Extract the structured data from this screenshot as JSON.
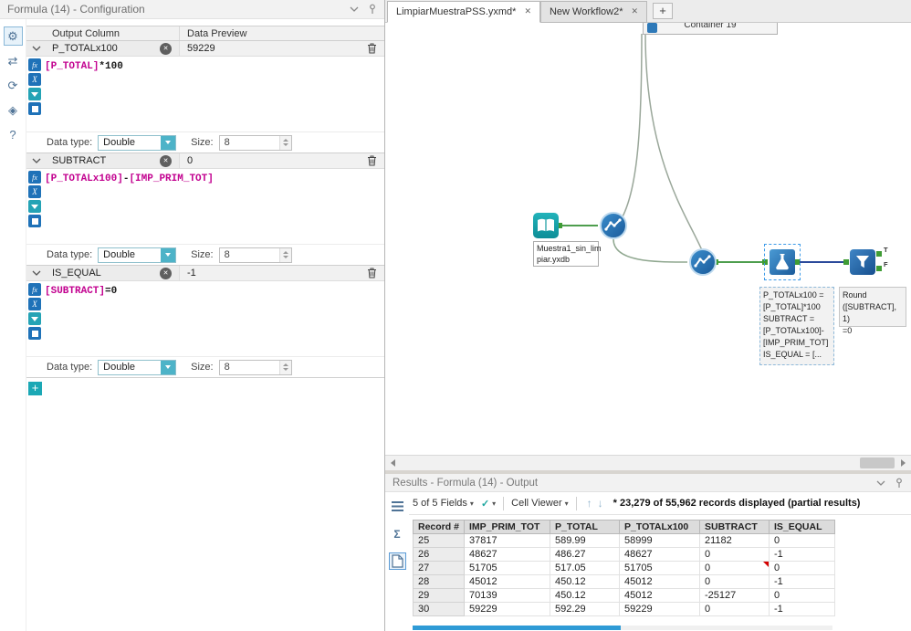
{
  "icons": {
    "gear": "⚙",
    "swap": "⇄",
    "refresh": "⟳",
    "tag": "◈",
    "help": "?",
    "close": "✕",
    "plus": "+",
    "check": "✓",
    "caret": "▾",
    "up_arrow": "↑",
    "down_arrow": "↓",
    "sigma": "Σ",
    "fx": "fx",
    "x_var": "X"
  },
  "config": {
    "title": "Formula (14) - Configuration",
    "header": {
      "output_column": "Output Column",
      "data_preview": "Data Preview"
    },
    "data_type_label": "Data type:",
    "size_label": "Size:",
    "formulas": [
      {
        "name": "P_TOTALx100",
        "preview": "59229",
        "expr": [
          {
            "t": "[P_TOTAL]"
          },
          {
            "t": "*100"
          }
        ],
        "data_type": "Double",
        "size": "8"
      },
      {
        "name": "SUBTRACT",
        "preview": "0",
        "expr": [
          {
            "t": "[P_TOTALx100]"
          },
          {
            "t": "-"
          },
          {
            "t": "[IMP_PRIM_TOT]"
          }
        ],
        "data_type": "Double",
        "size": "8"
      },
      {
        "name": "IS_EQUAL",
        "preview": "-1",
        "expr": [
          {
            "t": "[SUBTRACT]"
          },
          {
            "t": "=0"
          }
        ],
        "data_type": "Double",
        "size": "8"
      }
    ]
  },
  "tabs": {
    "items": [
      {
        "label": "LimpiarMuestraPSS.yxmd*"
      },
      {
        "label": "New Workflow2*"
      }
    ]
  },
  "canvas": {
    "container_label": "Container 19",
    "input_label": "Muestra1_sin_lim\npiar.yxdb",
    "formula_annotation": "P_TOTALx100 =\n[P_TOTAL]*100\nSUBTRACT =\n[P_TOTALx100]-\n[IMP_PRIM_TOT]\nIS_EQUAL = [...",
    "filter_annotation": "Round\n([SUBTRACT], 1)\n=0",
    "true_label": "T",
    "false_label": "F"
  },
  "results": {
    "title": "Results - Formula (14) - Output",
    "toolbar": {
      "fields": "5 of 5 Fields",
      "cell_viewer": "Cell Viewer",
      "records_info": "* 23,279 of 55,962 records displayed (partial results)"
    },
    "table": {
      "headers": [
        "Record #",
        "IMP_PRIM_TOT",
        "P_TOTAL",
        "P_TOTALx100",
        "SUBTRACT",
        "IS_EQUAL"
      ],
      "rows": [
        [
          "25",
          "37817",
          "589.99",
          "58999",
          "21182",
          "0"
        ],
        [
          "26",
          "48627",
          "486.27",
          "48627",
          "0",
          "-1"
        ],
        [
          "27",
          "51705",
          "517.05",
          "51705",
          "0",
          "0"
        ],
        [
          "28",
          "45012",
          "450.12",
          "45012",
          "0",
          "-1"
        ],
        [
          "29",
          "70139",
          "450.12",
          "45012",
          "-25127",
          "0"
        ],
        [
          "30",
          "59229",
          "592.29",
          "59229",
          "0",
          "-1"
        ]
      ],
      "flagged_cell": {
        "row": "27",
        "column": "SUBTRACT"
      }
    }
  }
}
